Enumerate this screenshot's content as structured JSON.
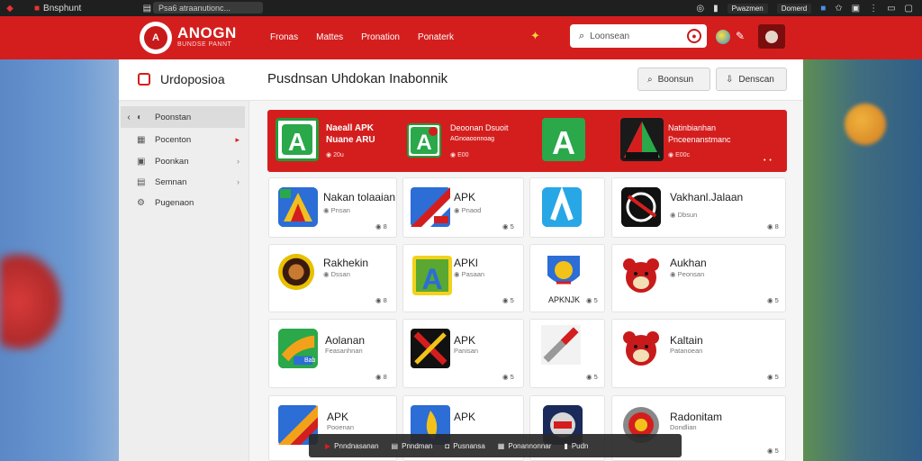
{
  "browser": {
    "tab_title": "Bnsphunt",
    "url": "Psa6 atraanutionc...",
    "right_pills": [
      "Pwazmen",
      "Domerd"
    ]
  },
  "header": {
    "brand": "ANOGN",
    "brand_sub": "BUNDSE PANNT",
    "logo_letter": "A",
    "nav": [
      "Fronas",
      "Mattes",
      "Pronation",
      "Ponaterk"
    ],
    "search_placeholder": "Loonsean"
  },
  "subheader": {
    "section": "Urdoposioa",
    "heading": "Pusdnsan Uhdokan Inabonnik",
    "buttons": [
      "Boonsun",
      "Denscan"
    ]
  },
  "sidebar": {
    "items": [
      {
        "label": "Poonstan",
        "active": true
      },
      {
        "label": "Pocenton",
        "active": false
      },
      {
        "label": "Poonkan",
        "active": false
      },
      {
        "label": "Semnan",
        "active": false
      },
      {
        "label": "Pugenaon",
        "active": false
      }
    ]
  },
  "banner": {
    "items": [
      {
        "title": "Naeall APK",
        "subtitle": "Nuane ARU",
        "meta": "20u"
      },
      {
        "title": "Deoonan Dsuoit",
        "subtitle": "AGnoaoonnoag",
        "meta": "E00"
      },
      {
        "title": "Natinbianhan",
        "subtitle": "Pnceenanstmanc",
        "meta": "E00c"
      }
    ],
    "dots": "• •"
  },
  "cards": [
    {
      "name": "Nakan tolaaian",
      "meta": "Pnsan",
      "foot": "8"
    },
    {
      "name": "APK",
      "meta": "Pnaod",
      "foot": "5"
    },
    {
      "name": "",
      "meta": "",
      "foot": ""
    },
    {
      "name": "Vakhanl.Jalaan",
      "meta": "Dbsun",
      "foot": "8"
    },
    {
      "name": "Rakhekin",
      "meta": "Dssan",
      "foot": "8"
    },
    {
      "name": "APKl",
      "meta": "Pasaan",
      "foot": "5"
    },
    {
      "name": "APK",
      "meta": "",
      "foot": "5"
    },
    {
      "name": "Aukhan",
      "meta": "Peonsan",
      "foot": "5"
    },
    {
      "name": "Aolanan",
      "meta": "Feasanhnan",
      "foot": "8"
    },
    {
      "name": "APK",
      "meta": "Panisan",
      "foot": "5"
    },
    {
      "name": "",
      "meta": "",
      "foot": "5"
    },
    {
      "name": "Kaltain",
      "meta": "Patanoean",
      "foot": "5"
    },
    {
      "name": "APK",
      "meta": "Pooenan",
      "foot": "5"
    },
    {
      "name": "APK",
      "meta": "",
      "foot": "5"
    },
    {
      "name": "",
      "meta": "",
      "foot": ""
    },
    {
      "name": "Radonitam",
      "meta": "Dondlian",
      "foot": "5"
    }
  ],
  "card_icon_texts": {
    "c1_badge": "Bab",
    "c3_label": "APKNJK"
  },
  "bottom_bar": [
    "Pnndnasanan",
    "Pnndman",
    "Pusnansa",
    "Ponannonnar",
    "Pudn"
  ],
  "colors": {
    "accent": "#d41e1e",
    "panel": "#f5f5f5"
  }
}
